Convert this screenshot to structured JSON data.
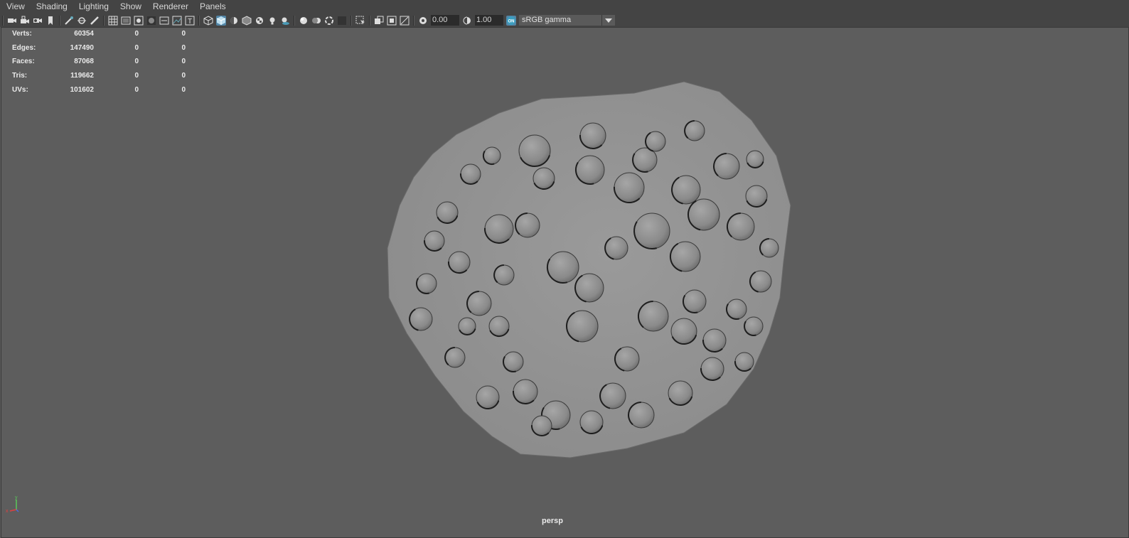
{
  "menubar": {
    "items": [
      {
        "label": "View"
      },
      {
        "label": "Shading"
      },
      {
        "label": "Lighting"
      },
      {
        "label": "Show"
      },
      {
        "label": "Renderer"
      },
      {
        "label": "Panels"
      }
    ]
  },
  "toolbar": {
    "exposure_value": "0.00",
    "gamma_value": "1.00",
    "color_management_badge": "ON",
    "colorspace_value": "sRGB gamma"
  },
  "hud": {
    "rows": [
      {
        "label": "Verts:",
        "v1": "60354",
        "v2": "0",
        "v3": "0"
      },
      {
        "label": "Edges:",
        "v1": "147490",
        "v2": "0",
        "v3": "0"
      },
      {
        "label": "Faces:",
        "v1": "87068",
        "v2": "0",
        "v3": "0"
      },
      {
        "label": "Tris:",
        "v1": "119662",
        "v2": "0",
        "v3": "0"
      },
      {
        "label": "UVs:",
        "v1": "101602",
        "v2": "0",
        "v3": "0"
      }
    ]
  },
  "viewport": {
    "camera_label": "persp",
    "axis_x": "x",
    "axis_y": "y"
  },
  "colors": {
    "accent": "#5285a6",
    "background": "#5d5d5d",
    "chrome": "#444444"
  }
}
